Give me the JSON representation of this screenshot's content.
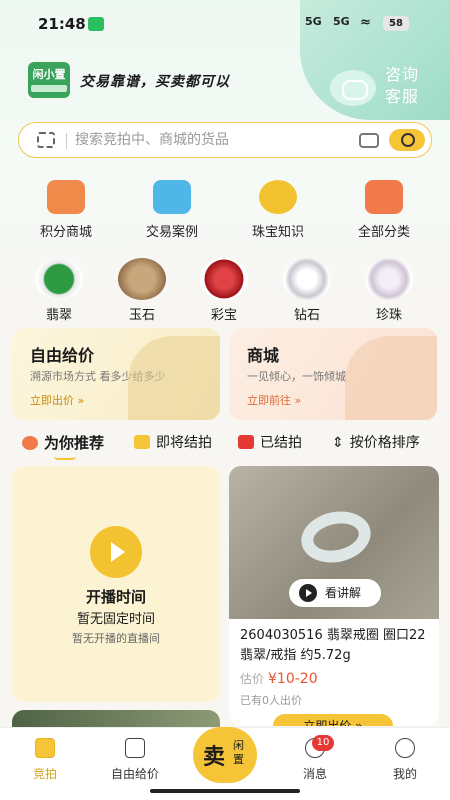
{
  "status": {
    "time": "21:48",
    "signal1": "5G",
    "signal2": "5G",
    "battery": "58"
  },
  "header": {
    "logo_text": "闲小置",
    "slogan": "交易靠谱，买卖都可以",
    "service_label_1": "咨询",
    "service_label_2": "客服"
  },
  "search": {
    "placeholder": "搜索竞拍中、商城的货品"
  },
  "quick_links": [
    {
      "label": "积分商城",
      "icon": "shop-icon",
      "color": "#f08a4b"
    },
    {
      "label": "交易案例",
      "icon": "box-icon",
      "color": "#4fb7e8"
    },
    {
      "label": "珠宝知识",
      "icon": "diamond-tag-icon",
      "color": "#f2c230"
    },
    {
      "label": "全部分类",
      "icon": "grid-icon",
      "color": "#f07a4a"
    }
  ],
  "categories": [
    {
      "label": "翡翠",
      "icon": "jade-ring-icon",
      "color": "#2e9b43"
    },
    {
      "label": "玉石",
      "icon": "jade-stone-icon",
      "color": "#c9a77c"
    },
    {
      "label": "彩宝",
      "icon": "ruby-icon",
      "color": "#c6272b"
    },
    {
      "label": "钻石",
      "icon": "diamond-ring-icon",
      "color": "#d8dadf"
    },
    {
      "label": "珍珠",
      "icon": "pearl-icon",
      "color": "#e9e3ea"
    }
  ],
  "cards": [
    {
      "title": "自由给价",
      "subtitle": "溯源市场方式 看多少给多少",
      "link": "立即出价 »"
    },
    {
      "title": "商城",
      "subtitle": "一见倾心，一饰倾城",
      "link": "立即前往 »"
    }
  ],
  "tabs": [
    {
      "label": "为你推荐"
    },
    {
      "label": "即将结拍"
    },
    {
      "label": "已结拍"
    },
    {
      "label": "按价格排序"
    }
  ],
  "live": {
    "title": "开播时间",
    "line1": "暂无固定时间",
    "line2": "暂无开播的直播间"
  },
  "product": {
    "title": "2604030516 翡翠戒圈 圈口22 翡翠/戒指 约5.72g",
    "price_label": "估价",
    "price": "¥10-20",
    "bids": "已有0人出价",
    "explain_label": "看讲解",
    "button": "立即出价 »"
  },
  "nav": {
    "items": [
      {
        "label": "竞拍"
      },
      {
        "label": "自由给价"
      },
      {
        "label": "消息"
      },
      {
        "label": "我的"
      }
    ],
    "sell_big": "卖",
    "sell_small": "闲置",
    "message_badge": "10"
  },
  "colors": {
    "accent": "#f5c537",
    "price": "#e4572e",
    "brand_green": "#3aa35c"
  }
}
